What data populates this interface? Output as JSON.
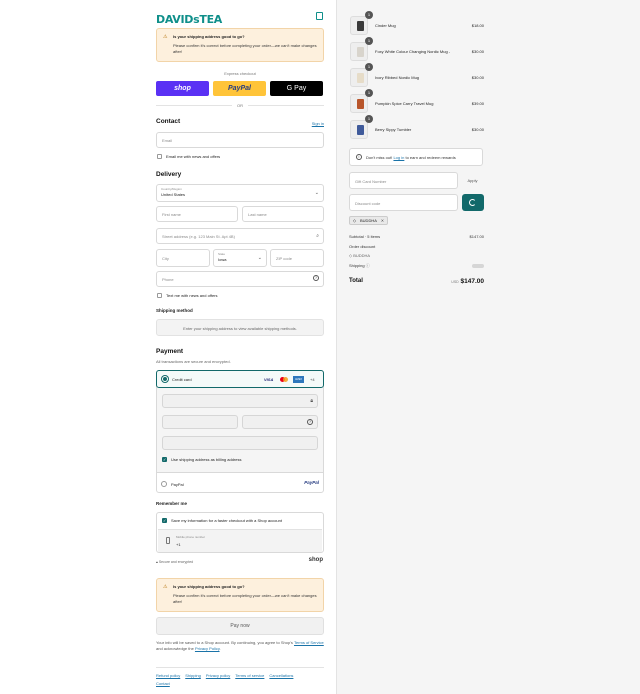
{
  "brand": {
    "logo": "DAVIDsTEA"
  },
  "alert": {
    "title": "Is your shipping address good to go?",
    "body": "Please confirm it's correct before completing your order—we can't make changes after!"
  },
  "express": {
    "label": "Express checkout",
    "shop": "shop",
    "paypal": "PayPal",
    "gpay": "G Pay",
    "or": "OR"
  },
  "contact": {
    "title": "Contact",
    "signin": "Sign in",
    "email_placeholder": "Email",
    "news": "Email me with news and offers"
  },
  "delivery": {
    "title": "Delivery",
    "country_label": "Country/Region",
    "country": "United States",
    "first": "First name",
    "last": "Last name",
    "address": "Street address (e.g. 123 Main St. Apt 4B)",
    "city": "City",
    "state_label": "State",
    "state": "Iowa",
    "zip": "ZIP code",
    "phone": "Phone",
    "text": "Text me with news and offers"
  },
  "shipping": {
    "title": "Shipping method",
    "msg": "Enter your shipping address to view available shipping methods."
  },
  "payment": {
    "title": "Payment",
    "sub": "All transactions are secure and encrypted.",
    "credit": "Credit card",
    "visa": "VISA",
    "amex": "AMEX",
    "more": "+4",
    "billing": "Use shipping address as billing address",
    "paypal": "PayPal",
    "paypal_logo": "PayPal"
  },
  "remember": {
    "title": "Remember me",
    "save": "Save my information for a faster checkout with a Shop account",
    "mobile_label": "Mobile phone number",
    "mobile_value": "+1",
    "secure": "Secure and encrypted",
    "shop": "shop"
  },
  "pay_button": "Pay now",
  "legal": {
    "pre": "Your info will be saved to a Shop account. By continuing, you agree to Shop's",
    "terms": "Terms of Service",
    "mid": "and acknowledge the",
    "privacy": "Privacy Policy",
    "end": "."
  },
  "footer": {
    "links": [
      "Refund policy",
      "Shipping",
      "Privacy policy",
      "Terms of service",
      "Cancellations",
      "Contact"
    ]
  },
  "cart": {
    "items": [
      {
        "qty": "1",
        "name": "Cinder Mug",
        "price": "$18.00",
        "color": "#3a3a3a"
      },
      {
        "qty": "1",
        "name": "Foxy White Colour Changing Nordic Mug -",
        "price": "$30.00",
        "color": "#d8d4cc"
      },
      {
        "qty": "1",
        "name": "Ivory Ribbed Nordic Mug",
        "price": "$30.00",
        "color": "#e6dcc8"
      },
      {
        "qty": "1",
        "name": "Pumpkin Spice Carry Travel Mug",
        "price": "$39.00",
        "color": "#b8552a"
      },
      {
        "qty": "1",
        "name": "Berry Sippy Tumbler",
        "price": "$30.00",
        "color": "#3f5a9a"
      }
    ],
    "rewards_pre": "Don't miss out!",
    "rewards_link": "Log in",
    "rewards_post": "to earn and redeem rewards",
    "gift_placeholder": "Gift Card Number",
    "apply": "Apply",
    "discount_placeholder": "Discount code",
    "code": "BUDDHA",
    "subtotal_label": "Subtotal · 5 items",
    "subtotal": "$147.00",
    "order_discount": "Order discount",
    "discount_code": "BUDDHA",
    "shipping_label": "Shipping",
    "total_label": "Total",
    "currency": "USD",
    "total": "$147.00"
  },
  "colors": {
    "brand": "#0f8f8a",
    "accent": "#12696a",
    "shop": "#5a31f4",
    "paypal": "#ffc439"
  }
}
